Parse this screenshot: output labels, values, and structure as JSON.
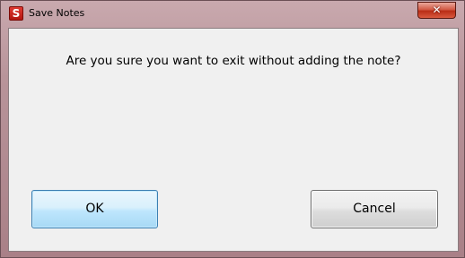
{
  "window": {
    "title": "Save Notes",
    "app_icon_letter": "S",
    "close_glyph": "✕"
  },
  "dialog": {
    "message": "Are you sure you want to exit without adding the note?",
    "ok_label": "OK",
    "cancel_label": "Cancel"
  },
  "icons": {
    "app": "app-logo-icon",
    "close": "close-icon"
  },
  "colors": {
    "frame": "#b8949a",
    "client_bg": "#f0f0f0",
    "default_button": "#bee6fd",
    "close_button": "#c8402a"
  }
}
